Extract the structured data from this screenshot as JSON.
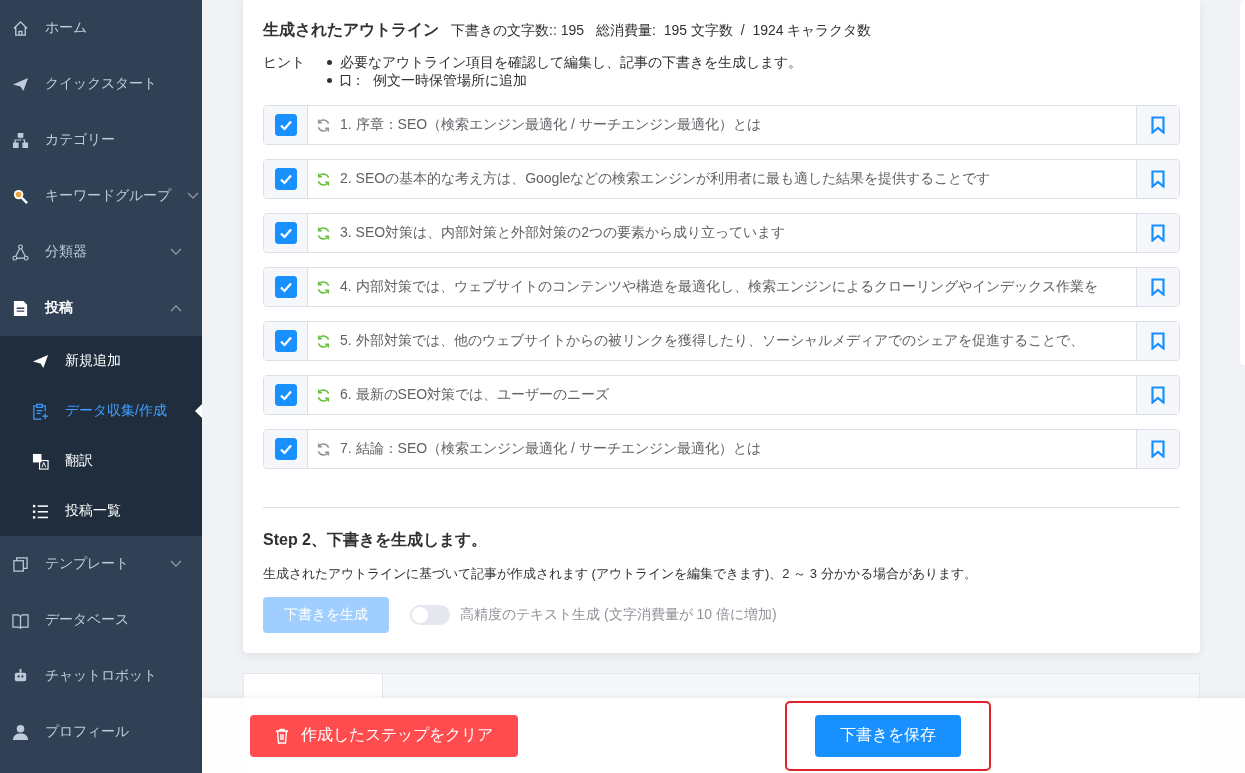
{
  "sidebar": {
    "items": [
      {
        "label": "ホーム",
        "kind": "link"
      },
      {
        "label": "クイックスタート",
        "kind": "link"
      },
      {
        "label": "カテゴリー",
        "kind": "link"
      },
      {
        "label": "キーワードグループ",
        "kind": "group",
        "expanded": false
      },
      {
        "label": "分類器",
        "kind": "group",
        "expanded": false
      },
      {
        "label": "投稿",
        "kind": "group",
        "expanded": true,
        "children": [
          {
            "label": "新規追加",
            "selected": false
          },
          {
            "label": "データ収集/作成",
            "selected": true
          },
          {
            "label": "翻訳",
            "selected": false
          },
          {
            "label": "投稿一覧",
            "selected": false
          }
        ]
      },
      {
        "label": "テンプレート",
        "kind": "group",
        "expanded": false
      },
      {
        "label": "データベース",
        "kind": "link"
      },
      {
        "label": "チャットロボット",
        "kind": "link"
      },
      {
        "label": "プロフィール",
        "kind": "link"
      }
    ]
  },
  "outline": {
    "title": "生成されたアウトライン",
    "draft_count": "下書きの文字数:: 195",
    "total_usage": "総消費量:  195 文字数  /  1924 キャラクタ数",
    "hint_label": "ヒント",
    "hints": [
      "必要なアウトライン項目を確認して編集し、記事の下書きを生成します。",
      "：  例文一時保管場所に追加"
    ],
    "items": [
      {
        "text": "1. 序章：SEO（検索エンジン最適化 / サーチエンジン最適化）とは",
        "checked": true,
        "color": "#909399"
      },
      {
        "text": "2. SEOの基本的な考え方は、Googleなどの検索エンジンが利用者に最も適した結果を提供することです",
        "checked": true,
        "color": "#67c23a"
      },
      {
        "text": "3. SEO対策は、内部対策と外部対策の2つの要素から成り立っています",
        "checked": true,
        "color": "#67c23a"
      },
      {
        "text": "4. 内部対策では、ウェブサイトのコンテンツや構造を最適化し、検索エンジンによるクローリングやインデックス作業を",
        "checked": true,
        "color": "#67c23a"
      },
      {
        "text": "5. 外部対策では、他のウェブサイトからの被リンクを獲得したり、ソーシャルメディアでのシェアを促進することで、",
        "checked": true,
        "color": "#67c23a"
      },
      {
        "text": "6. 最新のSEO対策では、ユーザーのニーズ",
        "checked": true,
        "color": "#67c23a"
      },
      {
        "text": "7. 結論：SEO（検索エンジン最適化 / サーチエンジン最適化）とは",
        "checked": true,
        "color": "#909399"
      }
    ]
  },
  "step2": {
    "title": "Step 2、下書きを生成します。",
    "description": "生成されたアウトラインに基づいて記事が作成されます (アウトラインを編集できます)、2 ～ 3 分かかる場合があります。",
    "generate_button": {
      "label": "下書きを生成",
      "disabled": true
    },
    "high_precision": {
      "label": "高精度のテキスト生成 (文字消費量が 10 倍に増加)",
      "on": false
    }
  },
  "footer": {
    "clear_button": "作成したステップをクリア",
    "save_button": "下書きを保存",
    "save_highlighted": true
  }
}
